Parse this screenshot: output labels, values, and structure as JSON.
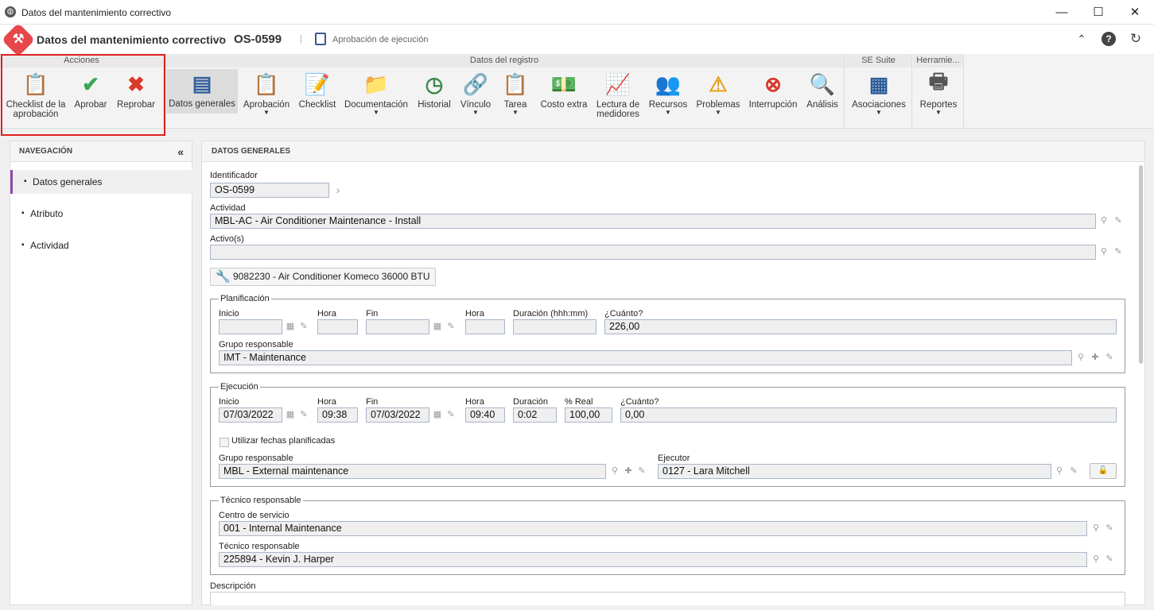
{
  "window": {
    "title": "Datos del mantenimiento correctivo",
    "min_icon": "—",
    "max_icon": "☐",
    "close_icon": "✕"
  },
  "header": {
    "title": "Datos del mantenimiento correctivo",
    "separator": "›",
    "code": "OS-0599",
    "status": "Aprobación de ejecución",
    "collapse_icon": "⌃",
    "help_icon": "?",
    "refresh_icon": "↻"
  },
  "ribbon": {
    "groups": {
      "acciones": "Acciones",
      "registro": "Datos del registro",
      "suite": "SE Suite",
      "herramientas": "Herramie..."
    },
    "acciones": [
      {
        "label": "Checklist de la aprobación",
        "icon": "checklist-approval-icon"
      },
      {
        "label": "Aprobar",
        "icon": "check-icon"
      },
      {
        "label": "Reprobar",
        "icon": "x-icon"
      }
    ],
    "registro": [
      {
        "label": "Datos generales",
        "icon": "form-icon"
      },
      {
        "label": "Aprobación",
        "icon": "approval-icon",
        "dropdown": true
      },
      {
        "label": "Checklist",
        "icon": "checklist-icon"
      },
      {
        "label": "Documentación",
        "icon": "folder-icon",
        "dropdown": true
      },
      {
        "label": "Historial",
        "icon": "history-icon"
      },
      {
        "label": "Vínculo",
        "icon": "link-icon",
        "dropdown": true
      },
      {
        "label": "Tarea",
        "icon": "task-icon",
        "dropdown": true
      },
      {
        "label": "Costo extra",
        "icon": "money-icon"
      },
      {
        "label": "Lectura de medidores",
        "icon": "meter-icon"
      },
      {
        "label": "Recursos",
        "icon": "resources-icon",
        "dropdown": true
      },
      {
        "label": "Problemas",
        "icon": "warning-icon",
        "dropdown": true
      },
      {
        "label": "Interrupción",
        "icon": "stop-icon"
      },
      {
        "label": "Análisis",
        "icon": "magnifier-icon"
      }
    ],
    "suite": [
      {
        "label": "Asociaciones",
        "icon": "associations-icon",
        "dropdown": true
      }
    ],
    "herramientas": [
      {
        "label": "Reportes",
        "icon": "printer-icon",
        "dropdown": true
      }
    ]
  },
  "nav": {
    "title": "NAVEGACIÓN",
    "collapse": "«",
    "items": [
      "Datos generales",
      "Atributo",
      "Actividad"
    ],
    "selected": 0
  },
  "main": {
    "title": "DATOS GENERALES",
    "identificador": {
      "label": "Identificador",
      "value": "OS-0599"
    },
    "actividad": {
      "label": "Actividad",
      "value": "MBL-AC - Air Conditioner Maintenance - Install"
    },
    "activos": {
      "label": "Activo(s)",
      "value": ""
    },
    "asset_button": "9082230 - Air Conditioner Komeco 36000 BTU",
    "planificacion": {
      "legend": "Planificación",
      "inicio": {
        "label": "Inicio",
        "value": ""
      },
      "hora1": {
        "label": "Hora",
        "value": ""
      },
      "fin": {
        "label": "Fin",
        "value": ""
      },
      "hora2": {
        "label": "Hora",
        "value": ""
      },
      "duracion": {
        "label": "Duración (hhh:mm)",
        "value": ""
      },
      "cuanto": {
        "label": "¿Cuánto?",
        "value": "226,00"
      },
      "grupo": {
        "label": "Grupo responsable",
        "value": "IMT - Maintenance"
      }
    },
    "ejecucion": {
      "legend": "Ejecución",
      "inicio": {
        "label": "Inicio",
        "value": "07/03/2022"
      },
      "hora1": {
        "label": "Hora",
        "value": "09:38"
      },
      "fin": {
        "label": "Fin",
        "value": "07/03/2022"
      },
      "hora2": {
        "label": "Hora",
        "value": "09:40"
      },
      "duracion": {
        "label": "Duración",
        "value": "0:02"
      },
      "real": {
        "label": "% Real",
        "value": "100,00"
      },
      "cuanto": {
        "label": "¿Cuánto?",
        "value": "0,00"
      },
      "planned_dates": "Utilizar fechas planificadas",
      "grupo": {
        "label": "Grupo responsable",
        "value": "MBL - External maintenance"
      },
      "ejecutor": {
        "label": "Ejecutor",
        "value": "0127 - Lara Mitchell"
      }
    },
    "tecnico": {
      "legend": "Técnico responsable",
      "centro": {
        "label": "Centro de servicio",
        "value": "001 - Internal Maintenance"
      },
      "tecnico": {
        "label": "Técnico responsable",
        "value": "225894 - Kevin J. Harper"
      }
    },
    "descripcion": {
      "label": "Descripción"
    }
  }
}
